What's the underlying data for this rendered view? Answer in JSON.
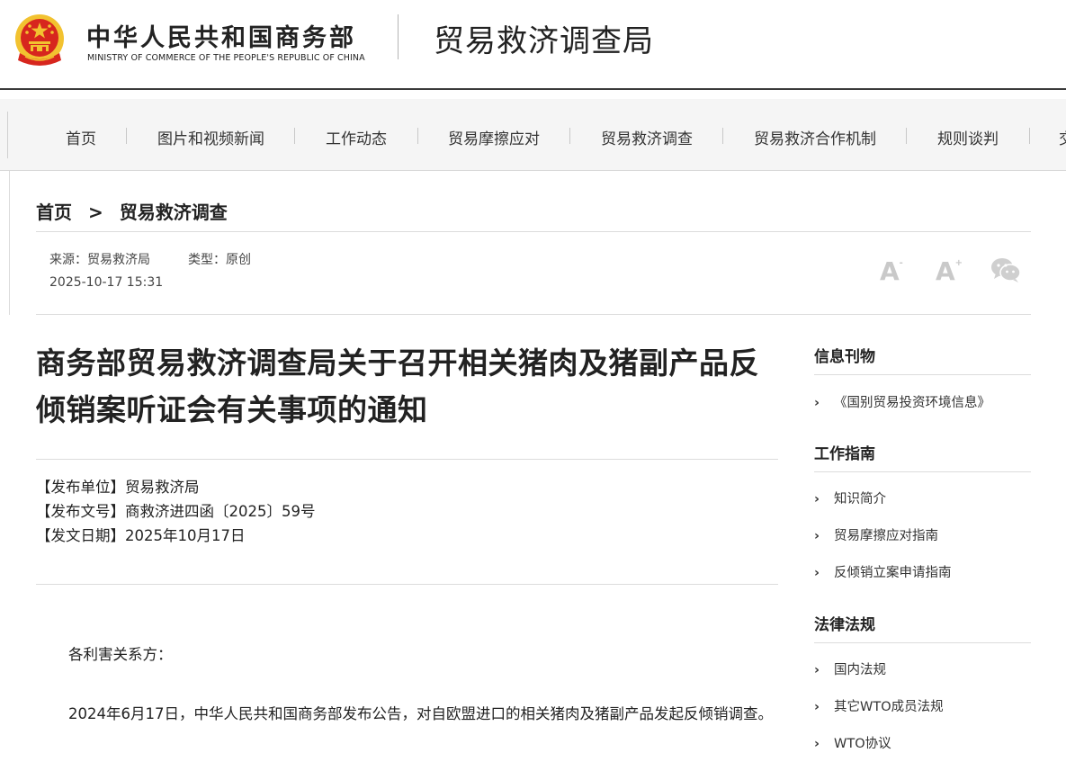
{
  "header": {
    "ministry_cn": "中华人民共和国商务部",
    "ministry_en": "MINISTRY OF COMMERCE OF THE PEOPLE'S REPUBLIC OF CHINA",
    "bureau": "贸易救济调查局"
  },
  "nav": {
    "items": [
      "首页",
      "图片和视频新闻",
      "工作动态",
      "贸易摩擦应对",
      "贸易救济调查",
      "贸易救济合作机制",
      "规则谈判",
      "交"
    ]
  },
  "breadcrumb": {
    "home": "首页",
    "separator": ">",
    "current": "贸易救济调查"
  },
  "meta": {
    "source": "来源：贸易救济局",
    "type": "类型：原创",
    "datetime": "2025-10-17 15:31"
  },
  "tools": {
    "font_decrease": "A",
    "font_decrease_mark": "-",
    "font_increase": "A",
    "font_increase_mark": "+"
  },
  "article": {
    "title": "商务部贸易救济调查局关于召开相关猪肉及猪副产品反倾销案听证会有关事项的通知",
    "issuer": "【发布单位】贸易救济局",
    "doc_number": "【发布文号】商救济进四函〔2025〕59号",
    "issue_date": "【发文日期】2025年10月17日",
    "salutation": "各利害关系方：",
    "paragraph1": "2024年6月17日，中华人民共和国商务部发布公告，对自欧盟进口的相关猪肉及猪副产品发起反倾销调查。"
  },
  "sidebar": {
    "sections": [
      {
        "heading": "信息刊物",
        "items": [
          "《国别贸易投资环境信息》"
        ]
      },
      {
        "heading": "工作指南",
        "items": [
          "知识简介",
          "贸易摩擦应对指南",
          "反倾销立案申请指南"
        ]
      },
      {
        "heading": "法律法规",
        "items": [
          "国内法规",
          "其它WTO成员法规",
          "WTO协议"
        ]
      }
    ]
  },
  "colors": {
    "emblem_red": "#d7261e",
    "emblem_gold": "#f2c230",
    "nav_bg": "#f5f5f5"
  }
}
